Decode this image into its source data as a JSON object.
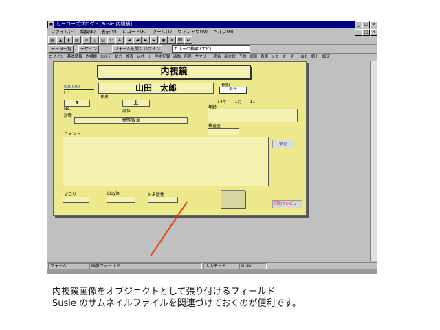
{
  "window": {
    "title": "ヒーローズブログ - [Susie 内視鏡]",
    "title_btns": [
      "_",
      "□",
      "×"
    ],
    "menu_items": [
      "ファイル(F)",
      "編集(E)",
      "表示(V)",
      "レコード(R)",
      "ツール(T)",
      "ウィンドウ(W)",
      "ヘルプ(H)"
    ],
    "menu_btns": [
      "_",
      "□",
      "×"
    ]
  },
  "toolbar1": {
    "buttons": [
      "▤",
      "▲",
      "▮",
      "▤",
      "✂",
      "▯",
      "◫",
      "↶",
      "A",
      "◄",
      "◄",
      "►",
      "►",
      "▣",
      "✕",
      "⌧",
      "↵"
    ]
  },
  "toolbar2": {
    "btn1": "データ一覧",
    "btn2": "デザイン",
    "btn3": "フォームを開く",
    "btn4": "ログイン",
    "combo": "カルテの検索 (ナビ)"
  },
  "tabs": [
    "ログイン",
    "基本情報",
    "内視鏡",
    "カルテ",
    "処方",
    "検査",
    "レポート",
    "手術記録",
    "画像",
    "所見",
    "サマリー",
    "病名",
    "紹介状",
    "予約",
    "病棟",
    "看護",
    "メモ",
    "オーダー",
    "会計",
    "統計",
    "設定"
  ],
  "form": {
    "title": "内視鏡",
    "id_value": "000000",
    "id_label": "I.D.",
    "name_value": "山田　太郎",
    "name_label": "氏名",
    "sex_label": "性別",
    "sex_value": "男性",
    "no_value": "1",
    "no_label": "No.",
    "part_value": "上",
    "part_label": "部位",
    "date_value": "14年　　1月　　11",
    "age_label": "年齢",
    "diag_label": "診断",
    "diag_value": "慢性胃炎",
    "doctor_label": "検査医",
    "comment_label": "コメント",
    "save_button": "保存",
    "check_labels": [
      "ピロリ",
      "Lipylor",
      "H.P.陰性"
    ],
    "image_field_label": "",
    "print_button": "印刷プレビュー"
  },
  "statusbar": {
    "left": "フォーム",
    "mid": "画像フィールド",
    "right1": "入力モード",
    "right2": "NUM"
  },
  "caption": {
    "line1": "内視鏡画像をオブジェクトとして張り付けるフィールド",
    "line2": "Susie のサムネイルファイルを関連づけておくのが便利です。"
  },
  "colors": {
    "title_bar": "#000080",
    "form_bg": "#ebe98c",
    "arrow": "#e83a18",
    "print_button_text": "#cc2255",
    "save_button_text": "#1a3ea0"
  }
}
